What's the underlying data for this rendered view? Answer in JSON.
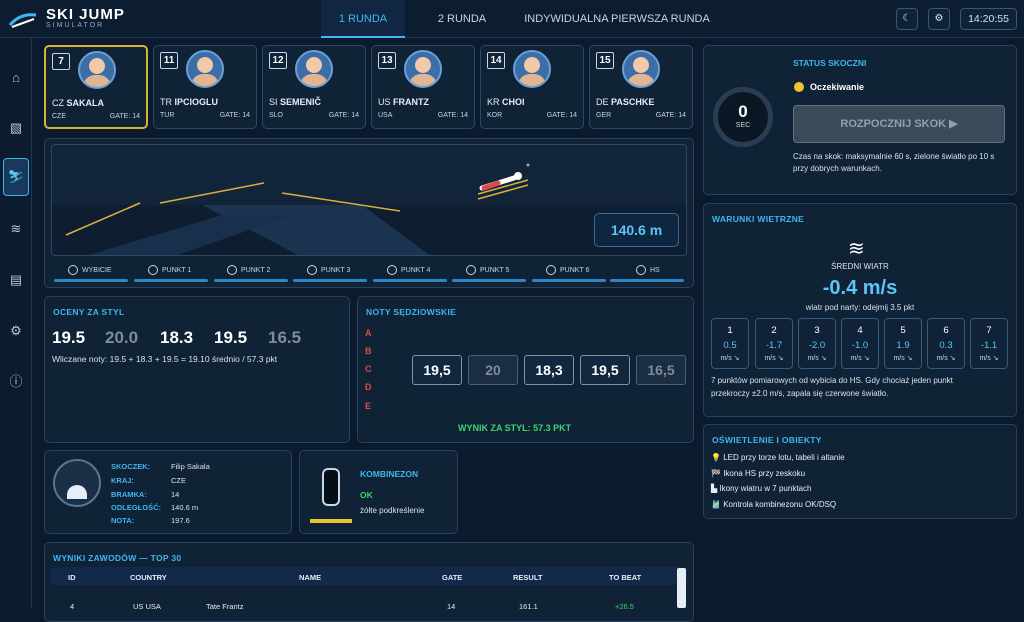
{
  "app": {
    "title": "SKI JUMP",
    "subtitle": "SIMULATOR",
    "time": "14:20:55",
    "moon_icon": "☾",
    "gear_icon": "⚙"
  },
  "tabs": [
    {
      "label": "1 RUNDA"
    },
    {
      "label": "2 RUNDA"
    },
    {
      "label": "INDYWIDUALNA PIERWSZA RUNDA"
    }
  ],
  "sidebar": [
    {
      "icon": "home-icon",
      "glyph": "⌂"
    },
    {
      "icon": "hill-icon",
      "glyph": "▧"
    },
    {
      "icon": "jump-icon",
      "glyph": "⛷"
    },
    {
      "icon": "wind-icon",
      "glyph": "≋"
    },
    {
      "icon": "list-icon",
      "glyph": "▤"
    },
    {
      "icon": "settings-icon",
      "glyph": "⚙"
    },
    {
      "icon": "info-icon",
      "glyph": "ⓘ"
    }
  ],
  "jumpers": [
    {
      "num": "7",
      "cc": "CZ",
      "name": "SAKALA",
      "country": "CZE",
      "gate": "GATE: 14"
    },
    {
      "num": "11",
      "cc": "TR",
      "name": "IPCIOGLU",
      "country": "TUR",
      "gate": "GATE: 14"
    },
    {
      "num": "12",
      "cc": "SI",
      "name": "SEMENIČ",
      "country": "SLO",
      "gate": "GATE: 14"
    },
    {
      "num": "13",
      "cc": "US",
      "name": "FRANTZ",
      "country": "USA",
      "gate": "GATE: 14"
    },
    {
      "num": "14",
      "cc": "KR",
      "name": "CHOI",
      "country": "KOR",
      "gate": "GATE: 14"
    },
    {
      "num": "15",
      "cc": "DE",
      "name": "PASCHKE",
      "country": "GER",
      "gate": "GATE: 14"
    }
  ],
  "scene": {
    "distance": "140.6 m"
  },
  "points": [
    "WYBICIE",
    "PUNKT 1",
    "PUNKT 2",
    "PUNKT 3",
    "PUNKT 4",
    "PUNKT 5",
    "PUNKT 6",
    "HS"
  ],
  "style_scores": {
    "title": "OCENY ZA STYL",
    "scores": [
      "19.5",
      "20.0",
      "18.3",
      "19.5",
      "16.5"
    ],
    "summary": "Wliczane noty: 19.5 + 18.3 + 19.5 = 19.10 średnio / 57.3 pkt"
  },
  "judges": {
    "title": "NOTY SĘDZIOWSKIE",
    "letters": [
      "A",
      "B",
      "C",
      "D",
      "E"
    ],
    "values": [
      "19,5",
      "20",
      "18,3",
      "19,5",
      "16,5"
    ],
    "result": "WYNIK ZA STYL: 57.3 PKT"
  },
  "info": {
    "labels": [
      "SKOCZEK:",
      "KRAJ:",
      "BRAMKA:",
      "ODLEGŁOŚĆ:",
      "NOTA:"
    ],
    "values": [
      "Filip Sakala",
      "CZE",
      "14",
      "140.6 m",
      "197.6"
    ]
  },
  "suit": {
    "title": "KOMBINEZON",
    "status": "OK",
    "note": "żółte podkreślenie"
  },
  "status": {
    "title": "STATUS SKOCZNI",
    "state": "Oczekiwanie",
    "timer": "0",
    "timer_unit": "SEC",
    "button": "ROZPOCZNIJ SKOK ▶",
    "desc": "Czas na skok: maksymalnie 60 s, zielone światło po 10 s przy dobrych warunkach.",
    "light_color": "#f2c230"
  },
  "wind": {
    "title": "WARUNKI WIETRZNE",
    "avg_label": "ŚREDNI WIATR",
    "avg": "-0.4 m/s",
    "sub": "wiatr pod narty: odejmij 3.5 pkt",
    "points": [
      {
        "n": "1",
        "v": "0.5",
        "u": "m/s ↘"
      },
      {
        "n": "2",
        "v": "-1.7",
        "u": "m/s ↘"
      },
      {
        "n": "3",
        "v": "-2.0",
        "u": "m/s ↘"
      },
      {
        "n": "4",
        "v": "-1.0",
        "u": "m/s ↘"
      },
      {
        "n": "5",
        "v": "1.9",
        "u": "m/s ↘"
      },
      {
        "n": "6",
        "v": "0.3",
        "u": "m/s ↘"
      },
      {
        "n": "7",
        "v": "-1.1",
        "u": "m/s ↘"
      }
    ],
    "desc1": "7 punktów pomiarowych od wybicia do HS. Gdy chociaż jeden punkt",
    "desc2": "przekroczy ±2.0 m/s, zapala się czerwone światło."
  },
  "lighting": {
    "title": "OŚWIETLENIE I OBIEKTY",
    "items": [
      {
        "icon": "💡",
        "text": "LED przy torze lotu, tabeli i altanie"
      },
      {
        "icon": "🏁",
        "text": "Ikona HS przy zeskoku"
      },
      {
        "icon": "▙",
        "text": "Ikony wiatru w 7 punktach"
      },
      {
        "icon": "🎽",
        "text": "Kontrola kombinezonu OK/DSQ"
      }
    ]
  },
  "results": {
    "title": "WYNIKI ZAWODÓW — TOP 30",
    "headers": [
      "ID",
      "COUNTRY",
      "NAME",
      "GATE",
      "RESULT",
      "TO BEAT"
    ],
    "rows": [
      [
        "4",
        "US USA",
        "Tate Frantz",
        "14",
        "161.1",
        "+26.5"
      ]
    ]
  }
}
